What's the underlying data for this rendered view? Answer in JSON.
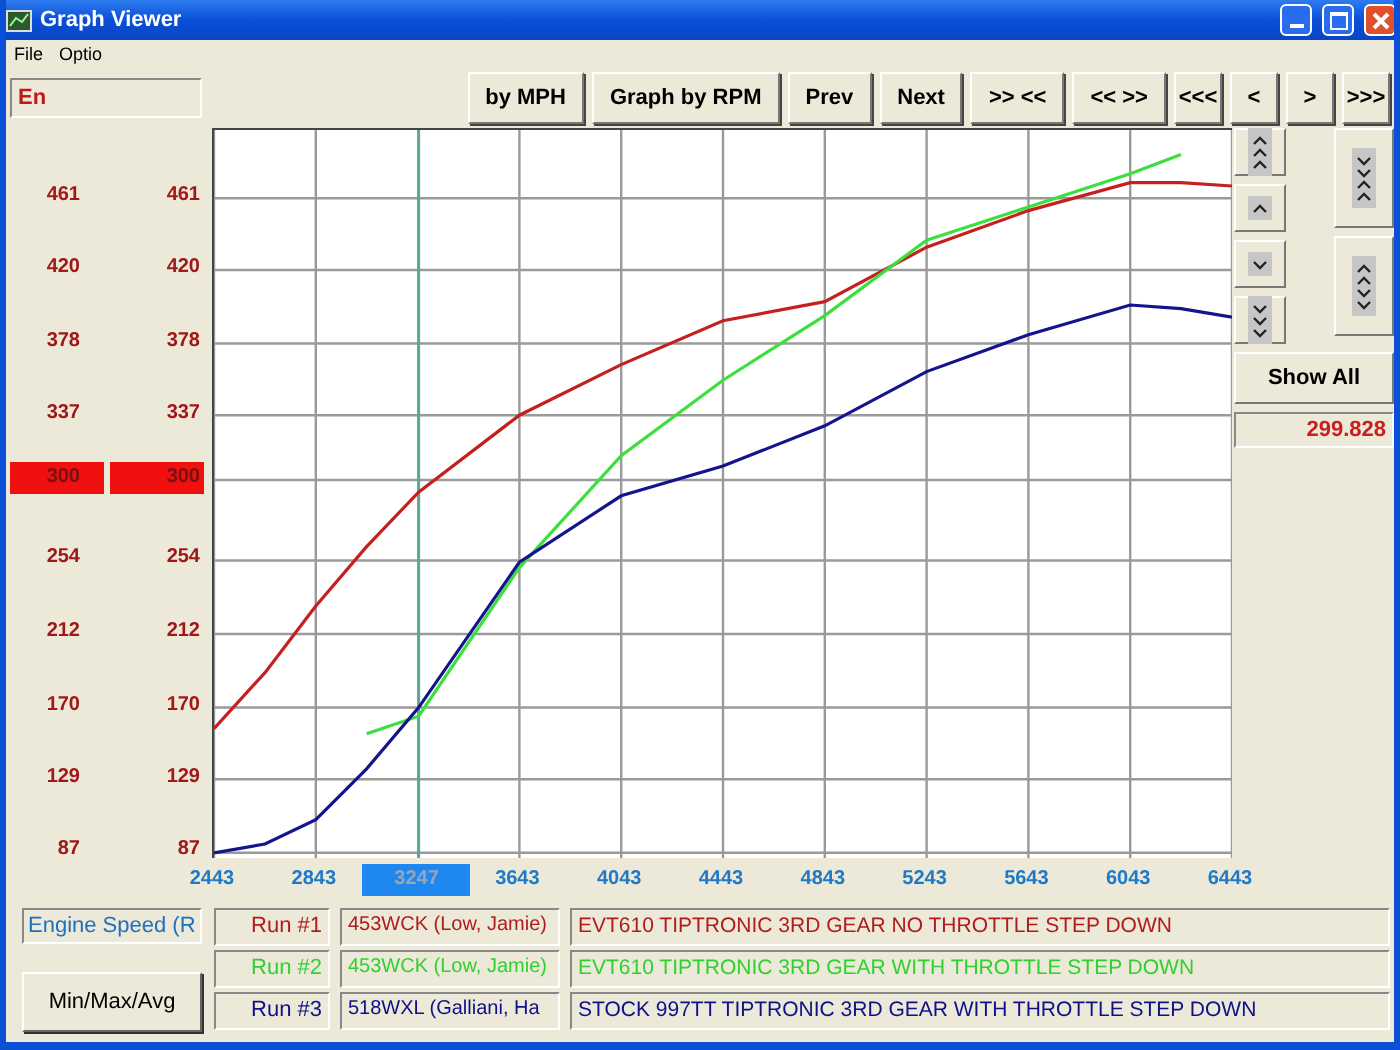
{
  "window": {
    "title": "Graph Viewer"
  },
  "menu": [
    "File",
    "Optio"
  ],
  "toolbar": {
    "field": "En",
    "buttons": [
      {
        "label": "by MPH",
        "kind": "wide"
      },
      {
        "label": "Graph by RPM",
        "kind": "wide"
      },
      {
        "label": "Prev",
        "kind": "wide"
      },
      {
        "label": "Next",
        "kind": "wide"
      },
      {
        "label": ">> <<",
        "kind": "wide"
      },
      {
        "label": "<< >>",
        "kind": "wide"
      },
      {
        "label": "<<<",
        "kind": "nav"
      },
      {
        "label": "<",
        "kind": "nav"
      },
      {
        "label": ">",
        "kind": "nav"
      },
      {
        "label": ">>>",
        "kind": "nav"
      }
    ]
  },
  "side_buttons": [
    {
      "kind": "up3"
    },
    {
      "kind": "up1"
    },
    {
      "kind": "down1"
    },
    {
      "kind": "down3"
    }
  ],
  "zoom_buttons": [
    {
      "kind": "expand"
    },
    {
      "kind": "compress"
    }
  ],
  "show_all": "Show All",
  "reading": "299.828",
  "graph": {
    "y_labels_left": [
      {
        "label": "461",
        "selected": false
      },
      {
        "label": "420",
        "selected": false
      },
      {
        "label": "378",
        "selected": false
      },
      {
        "label": "337",
        "selected": false
      },
      {
        "label": "300",
        "selected": true
      },
      {
        "label": "254",
        "selected": false
      },
      {
        "label": "212",
        "selected": false
      },
      {
        "label": "170",
        "selected": false
      },
      {
        "label": "129",
        "selected": false
      },
      {
        "label": "87",
        "selected": false
      }
    ],
    "x_tick_states": [
      {
        "selected": false
      },
      {
        "selected": false
      },
      {
        "selected": true
      },
      {
        "selected": false
      },
      {
        "selected": false
      },
      {
        "selected": false
      },
      {
        "selected": false
      },
      {
        "selected": false
      },
      {
        "selected": false
      },
      {
        "selected": false
      },
      {
        "selected": false
      }
    ],
    "chart_data": {
      "type": "line",
      "x": [
        2443,
        2643,
        2843,
        3043,
        3247,
        3643,
        4043,
        4443,
        4843,
        5243,
        5643,
        6043,
        6243,
        6443
      ],
      "series": [
        {
          "name": "Run #1",
          "color": "#c42020",
          "values": [
            158,
            190,
            228,
            262,
            293,
            337,
            366,
            391,
            402,
            433,
            454,
            470,
            470,
            468
          ]
        },
        {
          "name": "Run #2",
          "color": "#3ce03c",
          "values": [
            null,
            null,
            null,
            155,
            165,
            250,
            314,
            357,
            394,
            437,
            456,
            475,
            486,
            null
          ]
        },
        {
          "name": "Run #3",
          "color": "#14148c",
          "values": [
            87,
            92,
            106,
            135,
            170,
            253,
            291,
            308,
            331,
            362,
            383,
            400,
            398,
            393
          ]
        }
      ],
      "grid": true,
      "ref_lines": [
        {
          "axis": "x",
          "value": 3247,
          "color": "#5aa89a"
        }
      ],
      "xlim": [
        2443,
        6443
      ],
      "ylim": [
        84,
        500
      ],
      "xticks": [
        2443,
        2843,
        3247,
        3643,
        4043,
        4443,
        4843,
        5243,
        5643,
        6043,
        6443
      ],
      "yticks": [
        461,
        420,
        378,
        337,
        300,
        254,
        212,
        170,
        129,
        87
      ]
    }
  },
  "channel_field": "Engine Speed (R",
  "min_max_button": "Min/Max/Avg",
  "runs": [
    {
      "vehicle": "453WCK (Low, Jamie)",
      "description": "EVT610 TIPTRONIC 3RD GEAR NO THROTTLE STEP DOWN",
      "color": "#b01c1c"
    },
    {
      "vehicle": "453WCK (Low, Jamie)",
      "description": "EVT610 TIPTRONIC 3RD GEAR WITH THROTTLE STEP DOWN",
      "color": "#30d030"
    },
    {
      "vehicle": "518WXL (Galliani, Ha",
      "description": "STOCK 997TT TIPTRONIC 3RD GEAR WITH THROTTLE STEP DOWN",
      "color": "#10108a"
    }
  ]
}
